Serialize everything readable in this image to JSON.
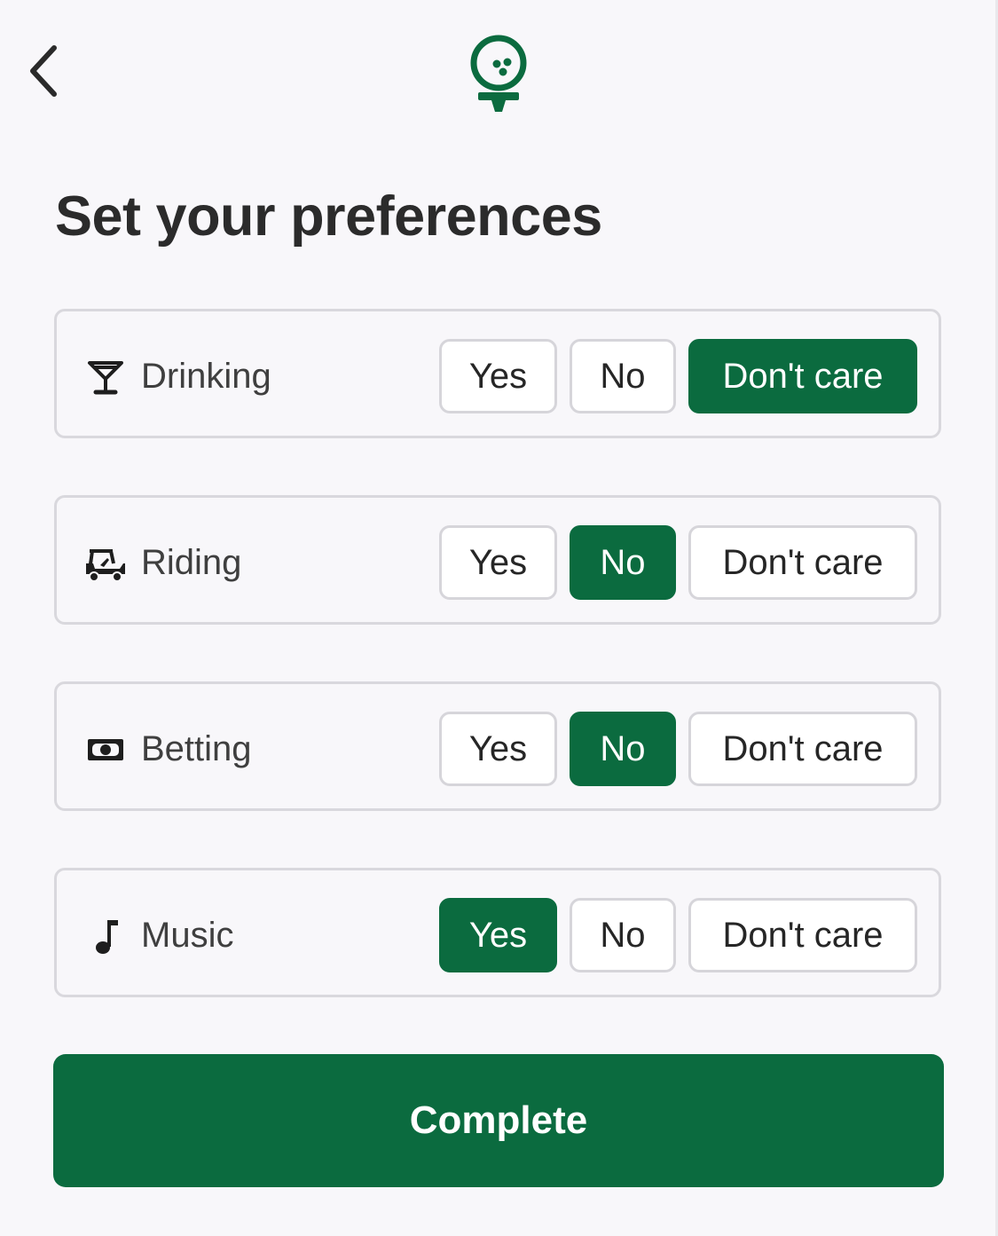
{
  "header": {
    "back_icon": "chevron-left-icon",
    "logo_icon": "golf-ball-on-tee-icon"
  },
  "title": "Set your preferences",
  "colors": {
    "accent": "#0b6b3f",
    "background": "#f8f7fa",
    "border": "#d9d8dd"
  },
  "preferences": [
    {
      "key": "drinking",
      "label": "Drinking",
      "icon": "cocktail-glass-icon",
      "options": [
        "Yes",
        "No",
        "Don't care"
      ],
      "selected": "Don't care"
    },
    {
      "key": "riding",
      "label": "Riding",
      "icon": "golf-cart-icon",
      "options": [
        "Yes",
        "No",
        "Don't care"
      ],
      "selected": "No"
    },
    {
      "key": "betting",
      "label": "Betting",
      "icon": "money-bill-icon",
      "options": [
        "Yes",
        "No",
        "Don't care"
      ],
      "selected": "No"
    },
    {
      "key": "music",
      "label": "Music",
      "icon": "music-note-icon",
      "options": [
        "Yes",
        "No",
        "Don't care"
      ],
      "selected": "Yes"
    }
  ],
  "complete_button": {
    "label": "Complete"
  }
}
